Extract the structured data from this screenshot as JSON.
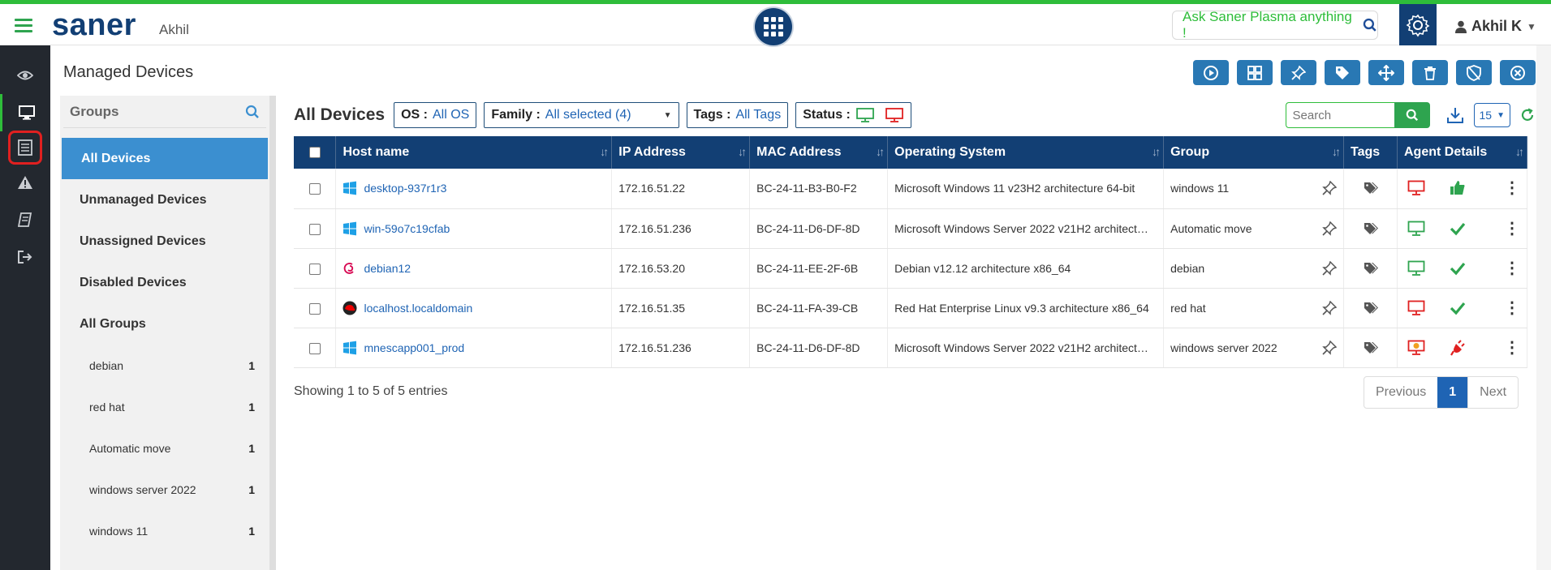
{
  "header": {
    "logo": "saner",
    "account": "Akhil",
    "ask_text": "Ask Saner Plasma anything !",
    "user_name": "Akhil K"
  },
  "page": {
    "title": "Managed Devices"
  },
  "groups": {
    "title": "Groups",
    "main_items": [
      "All Devices",
      "Unmanaged Devices",
      "Unassigned Devices",
      "Disabled Devices",
      "All Groups"
    ],
    "sub_items": [
      {
        "name": "debian",
        "count": "1"
      },
      {
        "name": "red hat",
        "count": "1"
      },
      {
        "name": "Automatic move",
        "count": "1"
      },
      {
        "name": "windows server 2022",
        "count": "1"
      },
      {
        "name": "windows 11",
        "count": "1"
      }
    ]
  },
  "filters": {
    "title": "All Devices",
    "os_label": "OS :",
    "os_value": "All OS",
    "family_label": "Family :",
    "family_value": "All selected (4)",
    "tags_label": "Tags :",
    "tags_value": "All Tags",
    "status_label": "Status :"
  },
  "search": {
    "placeholder": "Search"
  },
  "page_size": "15",
  "table": {
    "columns": [
      "Host name",
      "IP Address",
      "MAC Address",
      "Operating System",
      "Group",
      "Tags",
      "Agent Details"
    ],
    "rows": [
      {
        "os_icon": "windows",
        "host": "desktop-937r1r3",
        "ip": "172.16.51.22",
        "mac": "BC-24-11-B3-B0-F2",
        "os": "Microsoft Windows 11 v23H2 architecture 64-bit",
        "group": "windows 11",
        "monitor": "red",
        "agent": "thumbs-up"
      },
      {
        "os_icon": "windows",
        "host": "win-59o7c19cfab",
        "ip": "172.16.51.236",
        "mac": "BC-24-11-D6-DF-8D",
        "os": "Microsoft Windows Server 2022 v21H2 architectu...",
        "group": "Automatic move",
        "monitor": "green",
        "agent": "check"
      },
      {
        "os_icon": "debian",
        "host": "debian12",
        "ip": "172.16.53.20",
        "mac": "BC-24-11-EE-2F-6B",
        "os": "Debian v12.12 architecture x86_64",
        "group": "debian",
        "monitor": "green",
        "agent": "check"
      },
      {
        "os_icon": "redhat",
        "host": "localhost.localdomain",
        "ip": "172.16.51.35",
        "mac": "BC-24-11-FA-39-CB",
        "os": "Red Hat Enterprise Linux v9.3 architecture x86_64",
        "group": "red hat",
        "monitor": "red",
        "agent": "check"
      },
      {
        "os_icon": "windows",
        "host": "mnescapp001_prod",
        "ip": "172.16.51.236",
        "mac": "BC-24-11-D6-DF-8D",
        "os": "Microsoft Windows Server 2022 v21H2 architectu...",
        "group": "windows server 2022",
        "monitor": "red-alert",
        "agent": "plug"
      }
    ]
  },
  "footer": {
    "showing": "Showing 1 to 5 of 5 entries",
    "previous": "Previous",
    "current_page": "1",
    "next": "Next"
  },
  "colors": {
    "brand_navy": "#123f74",
    "accent_green": "#2ebd3a",
    "link_blue": "#1f64b4",
    "active_group": "#3b8fd0"
  }
}
